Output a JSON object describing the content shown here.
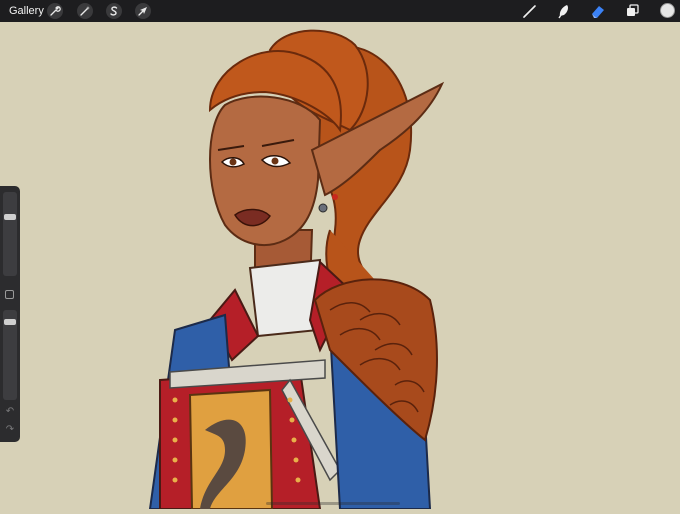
{
  "toolbar": {
    "gallery_label": "Gallery",
    "left_tools": [
      {
        "name": "actions",
        "icon": "wrench-icon"
      },
      {
        "name": "adjustments",
        "icon": "magic-wand-icon"
      },
      {
        "name": "selection",
        "icon": "selection-s-icon"
      },
      {
        "name": "transform",
        "icon": "arrow-cursor-icon"
      }
    ],
    "right_tools": [
      {
        "name": "brush",
        "icon": "brush-icon"
      },
      {
        "name": "smudge",
        "icon": "smudge-icon"
      },
      {
        "name": "eraser",
        "icon": "eraser-icon",
        "active": true
      },
      {
        "name": "layers",
        "icon": "layers-icon"
      }
    ],
    "current_color": "#e6e6e6",
    "active_tool_color": "#3b82f6"
  },
  "sidebar": {
    "brush_size_level": 0.1,
    "opacity_level": 0.03,
    "undo_icon": "undo-icon",
    "redo_icon": "redo-icon"
  },
  "canvas": {
    "background_color": "#d7d1b7",
    "artwork": "elf-portrait"
  }
}
